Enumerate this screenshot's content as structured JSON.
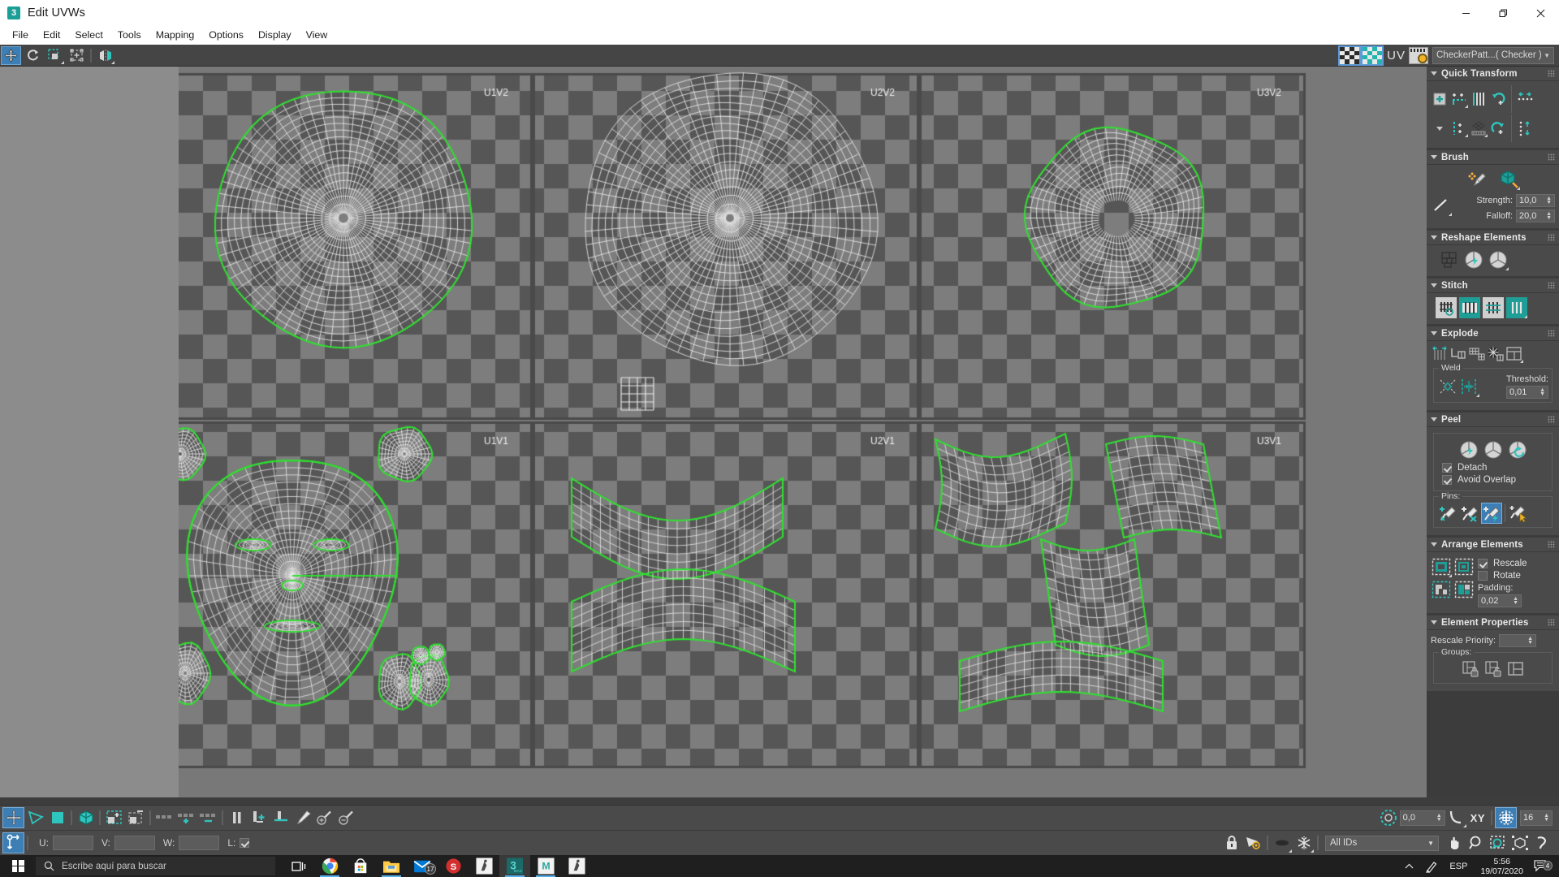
{
  "window": {
    "title": "Edit UVWs",
    "app_icon": "3",
    "controls": {
      "minimize": "minimize-icon",
      "restore": "restore-icon",
      "close": "close-icon"
    }
  },
  "menubar": {
    "items": [
      "File",
      "Edit",
      "Select",
      "Tools",
      "Mapping",
      "Options",
      "Display",
      "View"
    ]
  },
  "toolbar": {
    "left_tools": [
      {
        "name": "move-tool",
        "active": true
      },
      {
        "name": "rotate-tool",
        "active": false
      },
      {
        "name": "scale-tool",
        "active": false
      },
      {
        "name": "freeform-mode-tool",
        "active": false
      },
      {
        "name": "mirror-tool",
        "active": false
      }
    ],
    "right": {
      "checker_toggle": "checker-pattern-icon",
      "checker_teal": "checker-display-icon",
      "uv_label": "UV",
      "map_options": "map-options-gear-icon",
      "material_combo": "CheckerPatt...( Checker )"
    }
  },
  "viewport": {
    "tiles": [
      {
        "label": "U1V2",
        "col": 0,
        "row": 0
      },
      {
        "label": "U2V2",
        "col": 1,
        "row": 0
      },
      {
        "label": "U3V2",
        "col": 2,
        "row": 0
      },
      {
        "label": "U1V1",
        "col": 0,
        "row": 1
      },
      {
        "label": "U2V1",
        "col": 1,
        "row": 1
      },
      {
        "label": "U3V1",
        "col": 2,
        "row": 1
      }
    ],
    "checker_light": "#7d7d7d",
    "checker_dark": "#565656",
    "edge_color": "#2ee02e",
    "wire_color": "#e8e8e8"
  },
  "rollouts": {
    "quick_transform": {
      "title": "Quick Transform",
      "icons": [
        "align-pivot-icon",
        "align-horizontal-icon",
        "straighten-vertical-icon",
        "rotate-ccw-icon",
        "space-horizontal-icon",
        "align-vertical-icon",
        "align-add-icon",
        "relax-grid-icon",
        "rotate-cw-icon",
        "space-vertical-icon"
      ]
    },
    "brush": {
      "title": "Brush",
      "icons": [
        "paint-move-brush-icon",
        "paint-relax-brush-icon",
        "brush-strength-curve-icon"
      ],
      "strength_label": "Strength:",
      "strength_value": "10,0",
      "falloff_label": "Falloff:",
      "falloff_value": "20,0"
    },
    "reshape_elements": {
      "title": "Reshape Elements",
      "icons": [
        "flatten-by-angle-icon",
        "quick-peel-icon",
        "quick-planar-icon"
      ]
    },
    "stitch": {
      "title": "Stitch",
      "icons": [
        "stitch-custom-icon",
        "stitch-selected-icon",
        "stitch-to-target-icon",
        "stitch-diagonal-icon"
      ]
    },
    "explode": {
      "title": "Explode",
      "icons": [
        "break-icon",
        "break-angle-icon",
        "break-face-icon",
        "break-material-icon",
        "break-element-icon"
      ],
      "weld_label": "Weld",
      "weld_icons": [
        "target-weld-icon",
        "weld-selected-icon"
      ],
      "threshold_label": "Threshold:",
      "threshold_value": "0,01"
    },
    "peel": {
      "title": "Peel",
      "icons": [
        "quick-peel-icon",
        "peel-mode-icon",
        "peel-reset-icon"
      ],
      "detach_label": "Detach",
      "detach_checked": true,
      "avoid_overlap_label": "Avoid Overlap",
      "avoid_overlap_checked": true,
      "pins_label": "Pins:",
      "pin_icons": [
        "pin-add-icon",
        "pin-remove-icon",
        "pin-filter-icon",
        "pin-select-icon"
      ],
      "pin_selected_index": 2
    },
    "arrange_elements": {
      "title": "Arrange Elements",
      "icons": [
        "pack-normalize-icon",
        "pack-custom-icon",
        "pack-linear-icon",
        "pack-recursive-icon"
      ],
      "rescale_label": "Rescale",
      "rescale_checked": true,
      "rotate_label": "Rotate",
      "rotate_checked": false,
      "padding_label": "Padding:",
      "padding_value": "0,02"
    },
    "element_properties": {
      "title": "Element Properties",
      "rescale_priority_label": "Rescale Priority:",
      "rescale_priority_value": "",
      "groups_label": "Groups:",
      "group_icons": [
        "group-lock-icon",
        "group-unlock-icon",
        "group-clear-icon"
      ]
    }
  },
  "bottom_toolbar": {
    "left_icons": [
      "move-sub-icon",
      "vertex-mode-icon",
      "edge-mode-icon",
      "face-mode-icon",
      "select-element-icon",
      "select-by-element-icon",
      "filter-selected-faces-icon",
      "filter-add-icon",
      "filter-sub-icon",
      "mirror-axis-icon",
      "align-to-edge-icon",
      "align-horizontal-bottom-icon",
      "paintbrush-icon",
      "zoom-in-brush-icon",
      "zoom-out-brush-icon"
    ],
    "right": {
      "snap_angle_icon": "absolute-snap-icon",
      "angle_value": "0,0",
      "curve_icon": "falloff-curve-icon",
      "xy_label": "XY",
      "grid_snap_icon": "grid-snap-icon",
      "grid_snap_active": true,
      "grid_value": "16"
    }
  },
  "coord_bar": {
    "pivot_icon": "pivot-offset-icon",
    "u_label": "U:",
    "u_value": "",
    "v_label": "V:",
    "v_value": "",
    "w_label": "W:",
    "w_value": "",
    "l_label": "L:",
    "l_checked": true,
    "right_icons": [
      "lock-icon",
      "show-hidden-icon",
      "hide-icon",
      "freeze-icon"
    ],
    "id_combo": "All IDs",
    "nav_icons": [
      "pan-hand-icon",
      "zoom-icon",
      "zoom-region-icon",
      "zoom-extents-icon",
      "undo-view-icon"
    ]
  },
  "taskbar": {
    "search_placeholder": "Escribe aquí para buscar",
    "apps": [
      {
        "name": "task-view-icon",
        "running": false
      },
      {
        "name": "chrome-icon",
        "running": true
      },
      {
        "name": "microsoft-store-icon",
        "running": false
      },
      {
        "name": "file-explorer-icon",
        "running": true
      },
      {
        "name": "mail-icon",
        "running": false,
        "badge": "17"
      },
      {
        "name": "substance-painter-icon",
        "running": false
      },
      {
        "name": "zbrush-icon",
        "running": false
      },
      {
        "name": "3dsmax-icon",
        "running": true,
        "focused": true
      },
      {
        "name": "maya-icon",
        "running": true
      },
      {
        "name": "zbrush-core-icon",
        "running": false
      }
    ],
    "tray": {
      "chevron": "show-hidden-icons",
      "pen": "pen-icon",
      "language": "ESP",
      "time": "5:56",
      "date": "19/07/2020",
      "notification_count": "4"
    }
  }
}
